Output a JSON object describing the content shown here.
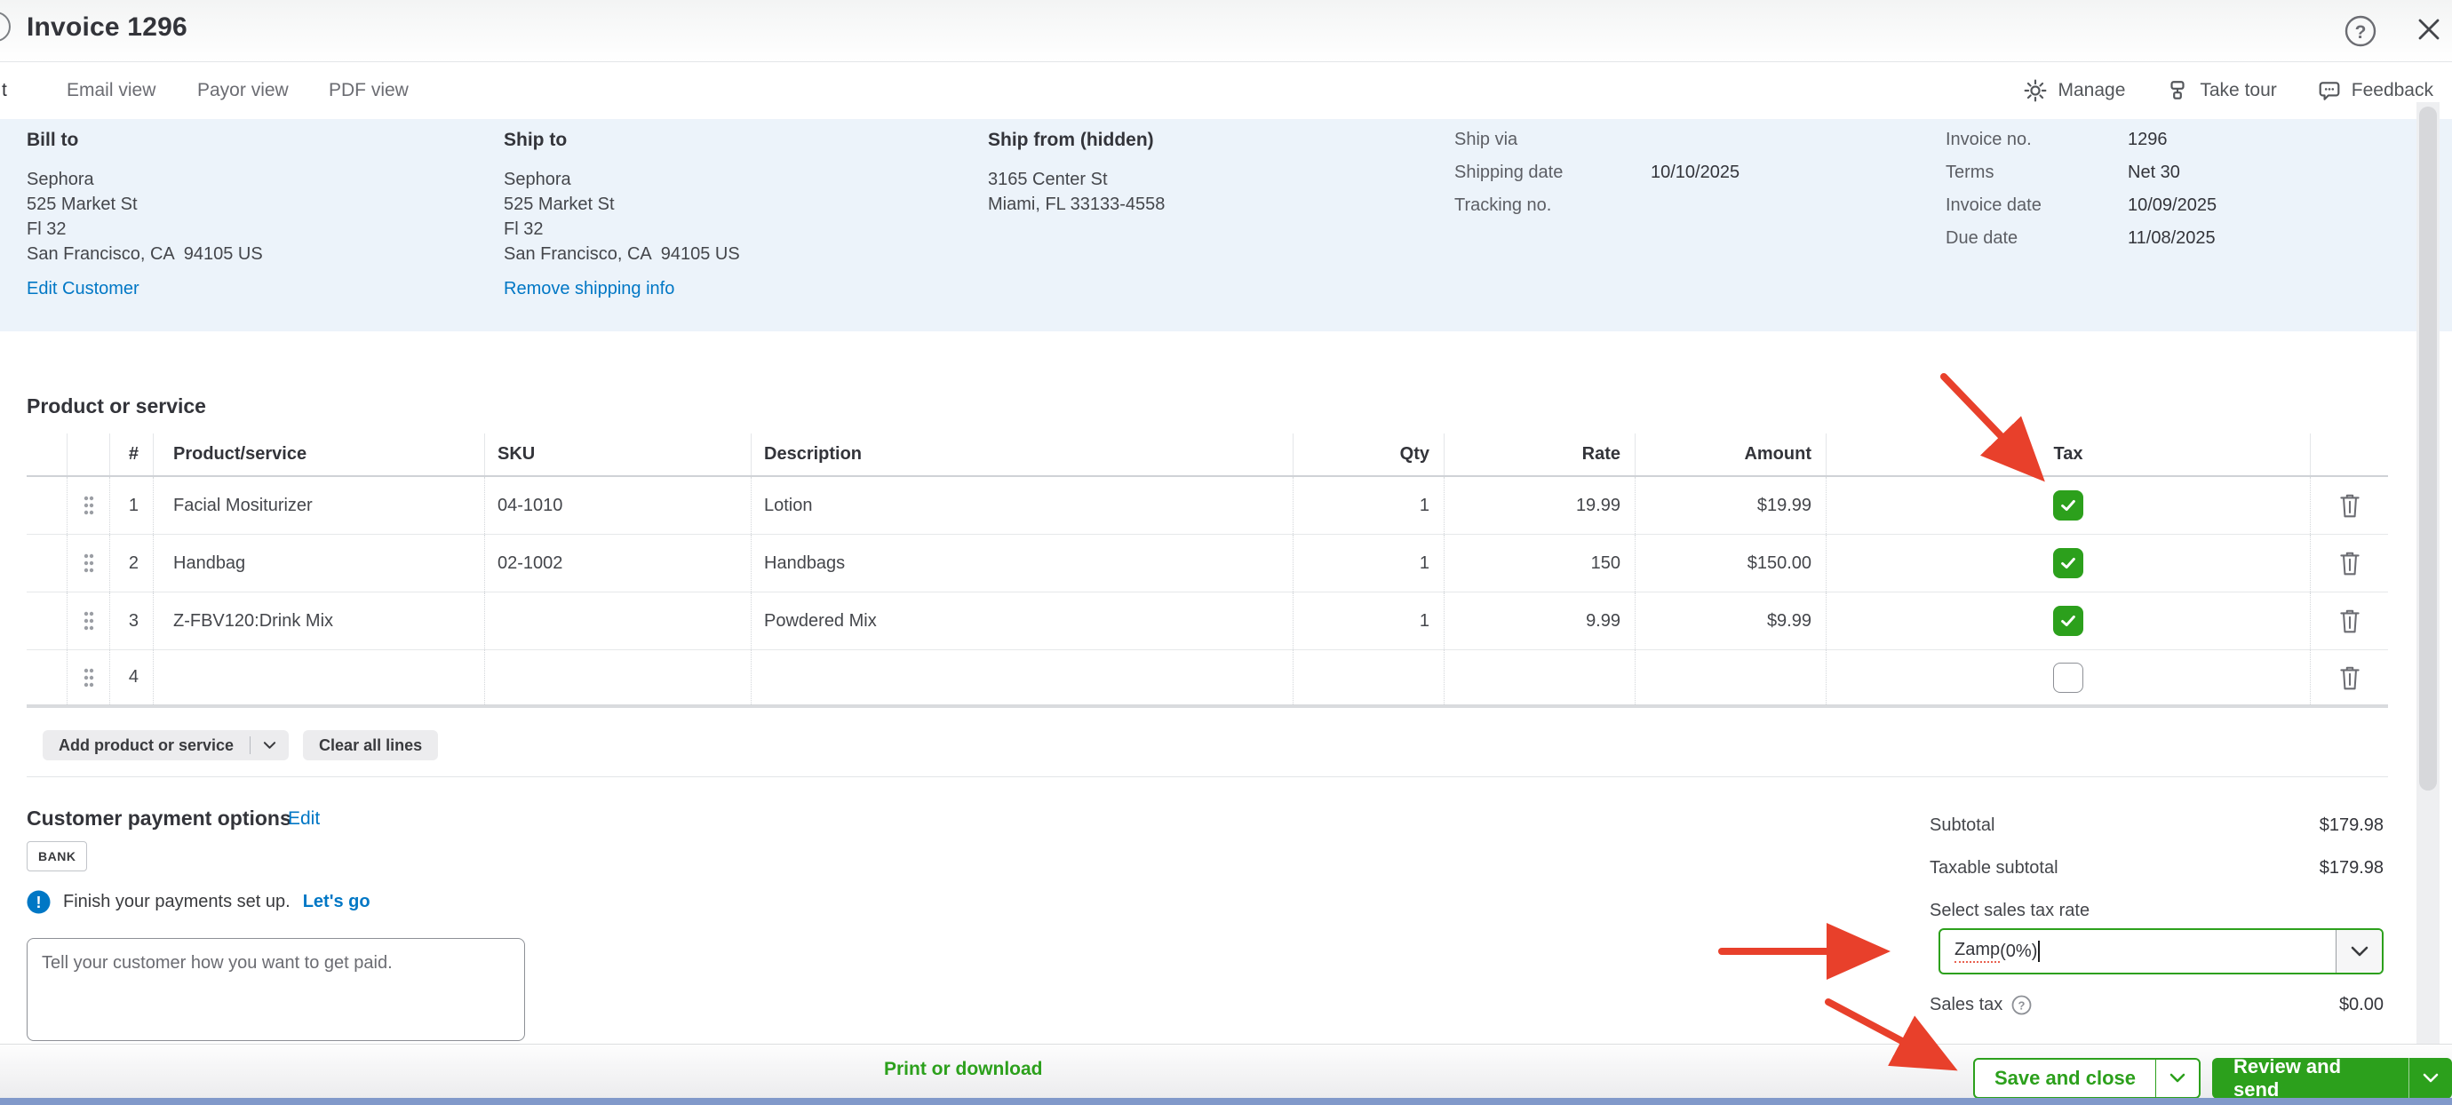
{
  "header": {
    "title": "Invoice 1296"
  },
  "tabs": {
    "cut_tab_label": "t",
    "items": [
      {
        "label": "Email view"
      },
      {
        "label": "Payor view"
      },
      {
        "label": "PDF view"
      }
    ],
    "actions": [
      {
        "icon": "gear-icon",
        "label": "Manage"
      },
      {
        "icon": "tour-signpost-icon",
        "label": "Take tour"
      },
      {
        "icon": "feedback-bubble-icon",
        "label": "Feedback"
      }
    ]
  },
  "parties": {
    "bill_to": {
      "heading": "Bill to",
      "lines": [
        "Sephora",
        "525 Market St",
        "Fl 32",
        "San Francisco, CA  94105 US"
      ],
      "link": "Edit Customer"
    },
    "ship_to": {
      "heading": "Ship to",
      "lines": [
        "Sephora",
        "525 Market St",
        "Fl 32",
        "San Francisco, CA  94105 US"
      ],
      "link": "Remove shipping info"
    },
    "ship_from": {
      "heading": "Ship from (hidden)",
      "lines": [
        "3165 Center St",
        "Miami, FL 33133-4558"
      ]
    },
    "shipping_fields": [
      {
        "label": "Ship via",
        "value": ""
      },
      {
        "label": "Shipping date",
        "value": "10/10/2025"
      },
      {
        "label": "Tracking no.",
        "value": ""
      }
    ],
    "invoice_fields": [
      {
        "label": "Invoice no.",
        "value": "1296"
      },
      {
        "label": "Terms",
        "value": "Net 30"
      },
      {
        "label": "Invoice date",
        "value": "10/09/2025"
      },
      {
        "label": "Due date",
        "value": "11/08/2025"
      }
    ]
  },
  "line_items": {
    "section_title": "Product or service",
    "columns": [
      "#",
      "Product/service",
      "SKU",
      "Description",
      "Qty",
      "Rate",
      "Amount",
      "Tax"
    ],
    "rows": [
      {
        "num": "1",
        "product": "Facial Mositurizer",
        "sku": "04-1010",
        "description": "Lotion",
        "qty": "1",
        "rate": "19.99",
        "amount": "$19.99",
        "tax_checked": true
      },
      {
        "num": "2",
        "product": "Handbag",
        "sku": "02-1002",
        "description": "Handbags",
        "qty": "1",
        "rate": "150",
        "amount": "$150.00",
        "tax_checked": true
      },
      {
        "num": "3",
        "product": "Z-FBV120:Drink Mix",
        "sku": "",
        "description": "Powdered Mix",
        "qty": "1",
        "rate": "9.99",
        "amount": "$9.99",
        "tax_checked": true
      },
      {
        "num": "4",
        "product": "",
        "sku": "",
        "description": "",
        "qty": "",
        "rate": "",
        "amount": "",
        "tax_checked": false
      }
    ],
    "add_button": "Add product or service",
    "clear_button": "Clear all lines"
  },
  "payments": {
    "heading": "Customer payment options",
    "edit_link": "Edit",
    "badge": "BANK",
    "notice": "Finish your payments set up.",
    "notice_link": "Let's go",
    "message_placeholder": "Tell your customer how you want to get paid."
  },
  "totals": {
    "subtotal_label": "Subtotal",
    "subtotal_value": "$179.98",
    "taxable_label": "Taxable subtotal",
    "taxable_value": "$179.98",
    "tax_rate_label": "Select sales tax rate",
    "tax_rate_word": "Zamp",
    "tax_rate_rest": " (0%)",
    "sales_tax_label": "Sales tax",
    "sales_tax_value": "$0.00"
  },
  "footer": {
    "print_link": "Print or download",
    "save_button": "Save and close",
    "review_button": "Review and send"
  },
  "colors": {
    "brand_green": "#2ca01c",
    "link_blue": "#0077c5",
    "annotation_red": "#e8402b",
    "info_band_blue": "#ecf3fa"
  }
}
